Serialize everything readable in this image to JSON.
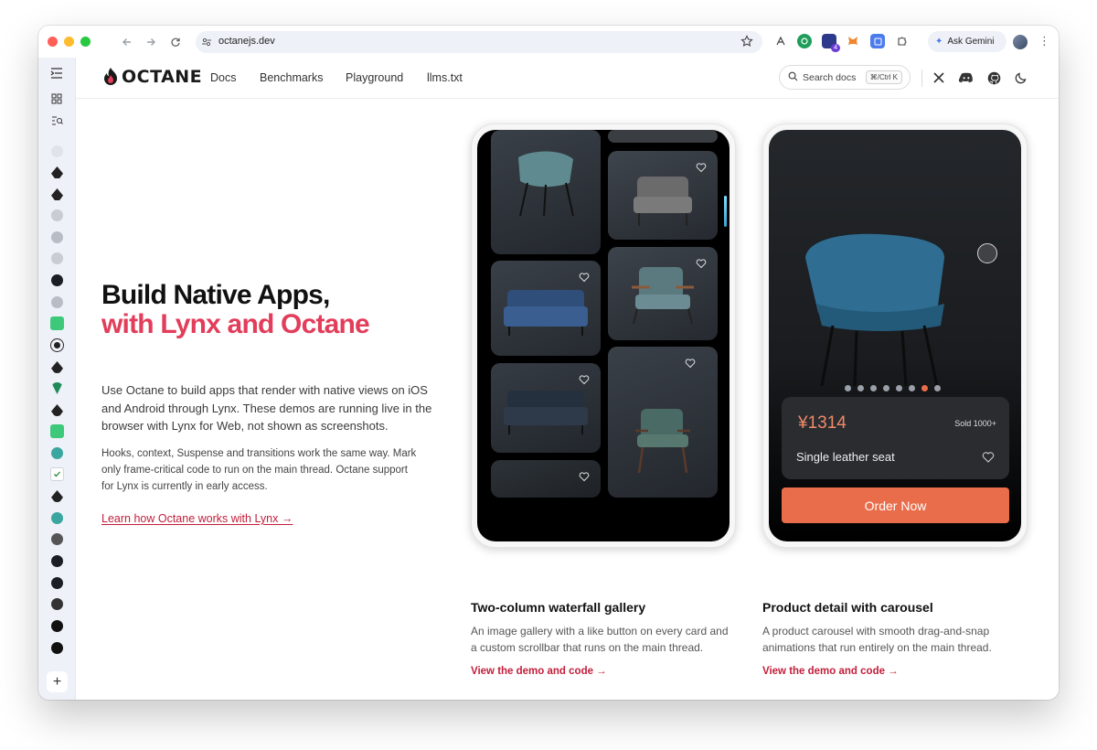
{
  "browser": {
    "url": "octanejs.dev",
    "ask_gemini": "Ask Gemini",
    "extension_badge": "4"
  },
  "site": {
    "logo_text": "OCTANE",
    "nav": [
      "Docs",
      "Benchmarks",
      "Playground",
      "llms.txt"
    ],
    "search_placeholder": "Search docs",
    "search_shortcut": "⌘/Ctrl K"
  },
  "hero": {
    "title_line1": "Build Native Apps,",
    "title_line2": "with Lynx and Octane",
    "lead": "Use Octane to build apps that render with native views on iOS and Android through Lynx. These demos are running live in the browser with Lynx for Web, not shown as screenshots.",
    "sub": "Hooks, context, Suspense and transitions work the same way. Mark only frame-critical code to run on the main thread. Octane support for Lynx is currently in early access.",
    "learn_link": "Learn how Octane works with Lynx →"
  },
  "demos": [
    {
      "title": "Two-column waterfall gallery",
      "body": "An image gallery with a like button on every card and a custom scrollbar that runs on the main thread.",
      "link": "View the demo and code →"
    },
    {
      "title": "Product detail with carousel",
      "body": "A product carousel with smooth drag-and-snap animations that run entirely on the main thread.",
      "link": "View the demo and code →"
    }
  ],
  "product": {
    "price": "¥1314",
    "sold": "Sold 1000+",
    "name": "Single leather seat",
    "order_button": "Order Now",
    "carousel_active_index": 6,
    "carousel_count": 8
  },
  "colors": {
    "accent": "#e23d5a",
    "link": "#c21e3a",
    "order_button": "#ea6d4b",
    "sidebar_bg": "#eef1f8"
  }
}
